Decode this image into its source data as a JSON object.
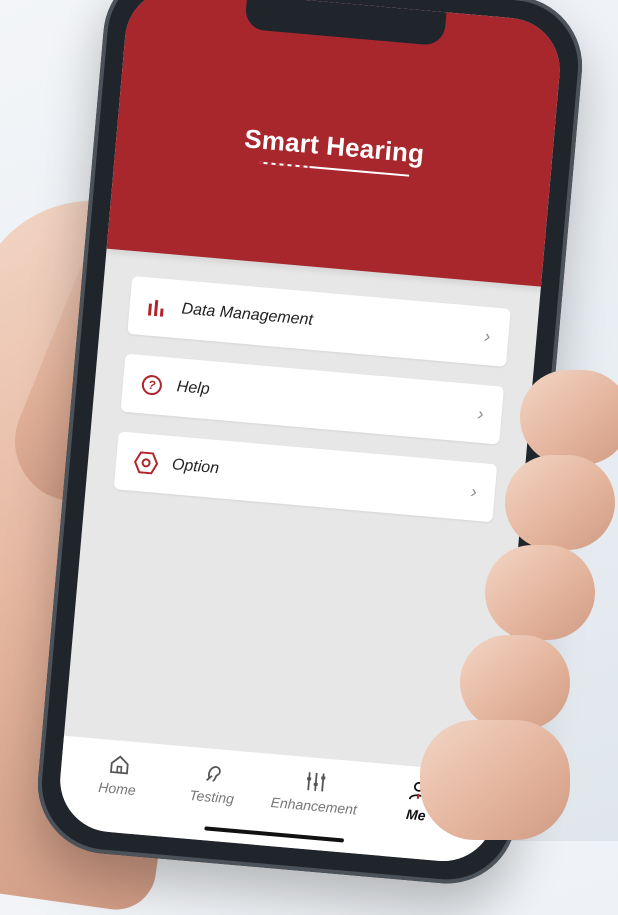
{
  "app": {
    "title": "Smart Hearing"
  },
  "menu": [
    {
      "label": "Data Management",
      "icon": "bar-chart-icon"
    },
    {
      "label": "Help",
      "icon": "help-circle-icon"
    },
    {
      "label": "Option",
      "icon": "settings-hex-icon"
    }
  ],
  "tabs": [
    {
      "label": "Home",
      "icon": "home-icon"
    },
    {
      "label": "Testing",
      "icon": "ear-icon"
    },
    {
      "label": "Enhancement",
      "icon": "equalizer-icon"
    },
    {
      "label": "Me",
      "icon": "user-icon",
      "active": true
    }
  ],
  "colors": {
    "accent": "#a8272d",
    "background": "#e7e7e7"
  }
}
